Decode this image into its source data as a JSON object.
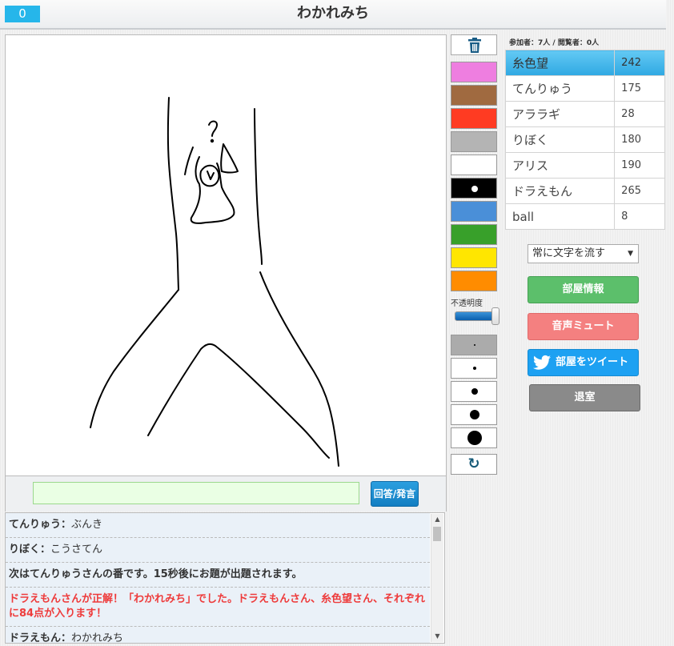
{
  "header": {
    "score": "0",
    "title": "わかれみち"
  },
  "input": {
    "placeholder": "",
    "value": "",
    "submit_label": "回答/発言"
  },
  "chat": {
    "messages": [
      {
        "type": "user",
        "user": "てんりゅう",
        "sep": "：",
        "text": "ぶんき"
      },
      {
        "type": "user",
        "user": "りぼく",
        "sep": "：",
        "text": "こうさてん"
      },
      {
        "type": "system",
        "text": "次はてんりゅうさんの番です。15秒後にお題が出題されます。"
      },
      {
        "type": "success",
        "text": "ドラえもんさんが正解！「わかれみち」でした。ドラえもんさん、糸色望さん、それぞれに84点が入ります！"
      },
      {
        "type": "user",
        "user": "ドラえもん",
        "sep": "：",
        "text": "わかれみち"
      }
    ]
  },
  "tools": {
    "trash_icon": "trash-icon",
    "colors": [
      "#ee7ee0",
      "#a06a40",
      "#ff3b22",
      "#b4b4b4",
      "#ffffff",
      "#000000",
      "#4a8fd8",
      "#38a02a",
      "#ffe600",
      "#ff8c00"
    ],
    "opacity_label": "不透明度",
    "opacity_value": 1.0,
    "pen_sizes_count": 5,
    "selected_size_index": 0,
    "undo_icon": "undo-icon"
  },
  "participants": {
    "label": "参加者：7人 / 閲覧者：0人",
    "players": [
      {
        "name": "糸色望",
        "score": "242",
        "current": true
      },
      {
        "name": "てんりゅう",
        "score": "175",
        "current": false
      },
      {
        "name": "アララギ",
        "score": "28",
        "current": false
      },
      {
        "name": "りぼく",
        "score": "180",
        "current": false
      },
      {
        "name": "アリス",
        "score": "190",
        "current": false
      },
      {
        "name": "ドラえもん",
        "score": "265",
        "current": false
      },
      {
        "name": "ball",
        "score": "8",
        "current": false
      }
    ]
  },
  "settings": {
    "flow_select_value": "常に文字を流す"
  },
  "buttons": {
    "room_info": "部屋情報",
    "mute": "音声ミュート",
    "tweet": "部屋をツイート",
    "leave": "退室"
  },
  "drawing": {
    "question_mark": "?"
  }
}
